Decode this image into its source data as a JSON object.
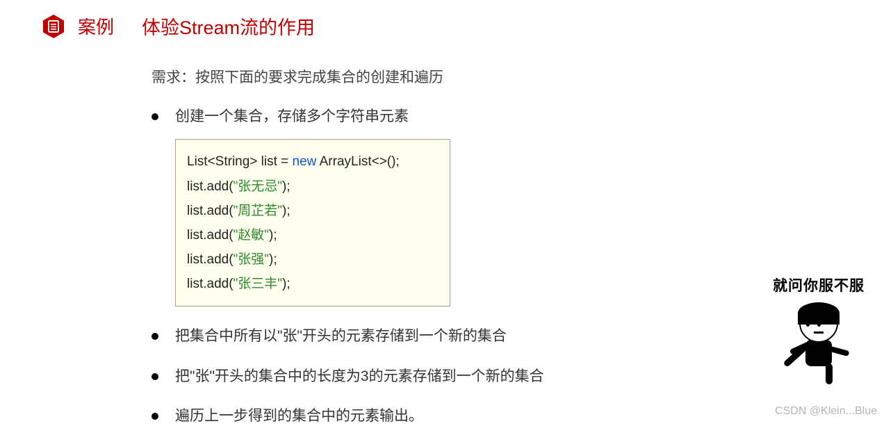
{
  "header": {
    "badge_label": "案例",
    "title": "体验Stream流的作用"
  },
  "requirement": "需求：按照下面的要求完成集合的创建和遍历",
  "bullets": {
    "b1": "创建一个集合，存储多个字符串元素",
    "b2": "把集合中所有以\"张\"开头的元素存储到一个新的集合",
    "b3": "把\"张\"开头的集合中的长度为3的元素存储到一个新的集合",
    "b4": "遍历上一步得到的集合中的元素输出。"
  },
  "code": {
    "line1_pre": "List<String> list = ",
    "line1_kw": "new",
    "line1_post": " ArrayList<>();",
    "add_prefix": "list.add(",
    "add_suffix": ");",
    "strings": [
      "\"张无忌\"",
      "\"周芷若\"",
      "\"赵敏\"",
      "\"张强\"",
      "\"张三丰\""
    ]
  },
  "meme": {
    "caption": "就问你服不服"
  },
  "watermark": "CSDN @Klein...Blue"
}
